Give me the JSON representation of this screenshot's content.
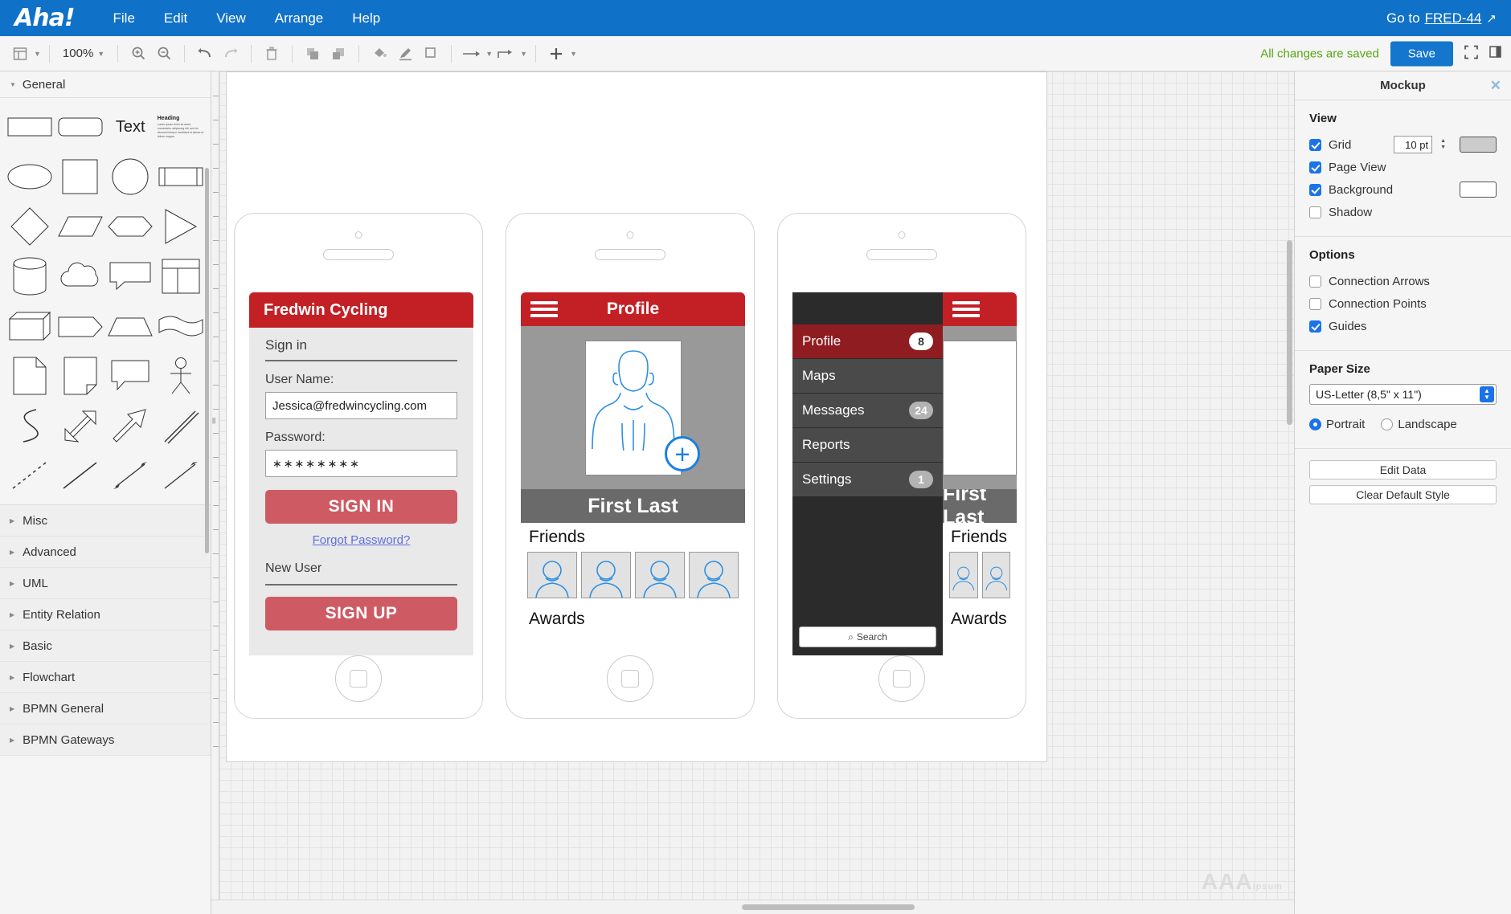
{
  "menubar": {
    "logo": "Aha!",
    "items": [
      "File",
      "Edit",
      "View",
      "Arrange",
      "Help"
    ],
    "goto_prefix": "Go to",
    "goto_link": "FRED-44",
    "ext_icon": "↗"
  },
  "toolbar": {
    "zoom": "100%",
    "saved_message": "All changes are saved",
    "save_label": "Save",
    "icons": [
      "layout-icon",
      "zoom-in-icon",
      "zoom-out-icon",
      "undo-icon",
      "redo-icon",
      "delete-icon",
      "to-front-icon",
      "to-back-icon",
      "fill-color-icon",
      "line-color-icon",
      "shadow-icon",
      "connection-icon",
      "waypoints-icon",
      "insert-icon",
      "fullscreen-icon",
      "panel-toggle-icon"
    ]
  },
  "shapes_panel": {
    "section_title": "General",
    "text_shape_label": "Text",
    "heading_shape_label": "Heading",
    "heading_body": "Lorem ipsum dolor sit amet, consectetur adipiscing elit, sed do eiusmod tempor incididunt ut labore et dolore magna.",
    "categories": [
      "Misc",
      "Advanced",
      "UML",
      "Entity Relation",
      "Basic",
      "Flowchart",
      "BPMN General",
      "BPMN Gateways"
    ]
  },
  "mockups": {
    "phone1": {
      "app_title": "Fredwin Cycling",
      "section": "Sign in",
      "username_label": "User Name:",
      "username_value": "Jessica@fredwincycling.com",
      "password_label": "Password:",
      "password_value": "∗∗∗∗∗∗∗∗",
      "signin_button": "SIGN IN",
      "forgot_link": "Forgot Password?",
      "new_user": "New User",
      "signup_button": "SIGN UP"
    },
    "phone2": {
      "title": "Profile",
      "name": "First Last",
      "friends_heading": "Friends",
      "awards_heading": "Awards",
      "add_photo_icon": "+"
    },
    "phone3": {
      "menu_items": [
        {
          "label": "Profile",
          "badge": "8",
          "active": true
        },
        {
          "label": "Maps",
          "badge": "",
          "active": false
        },
        {
          "label": "Messages",
          "badge": "24",
          "active": false
        },
        {
          "label": "Reports",
          "badge": "",
          "active": false
        },
        {
          "label": "Settings",
          "badge": "1",
          "active": false
        }
      ],
      "search_placeholder": "Search",
      "search_icon": "⌕",
      "name": "First Last",
      "friends_heading": "Friends",
      "awards_heading": "Awards"
    }
  },
  "right_panel": {
    "title": "Mockup",
    "close_icon": "✕",
    "view": {
      "heading": "View",
      "grid_label": "Grid",
      "grid_size": "10 pt",
      "page_view_label": "Page View",
      "background_label": "Background",
      "shadow_label": "Shadow"
    },
    "options": {
      "heading": "Options",
      "connection_arrows_label": "Connection Arrows",
      "connection_points_label": "Connection Points",
      "guides_label": "Guides"
    },
    "paper": {
      "heading": "Paper Size",
      "selected": "US-Letter (8,5\" x 11\")",
      "portrait_label": "Portrait",
      "landscape_label": "Landscape"
    },
    "buttons": {
      "edit_data": "Edit Data",
      "clear_default_style": "Clear Default Style"
    }
  },
  "watermark": {
    "text": "AAA",
    "sub": "ipsum"
  }
}
